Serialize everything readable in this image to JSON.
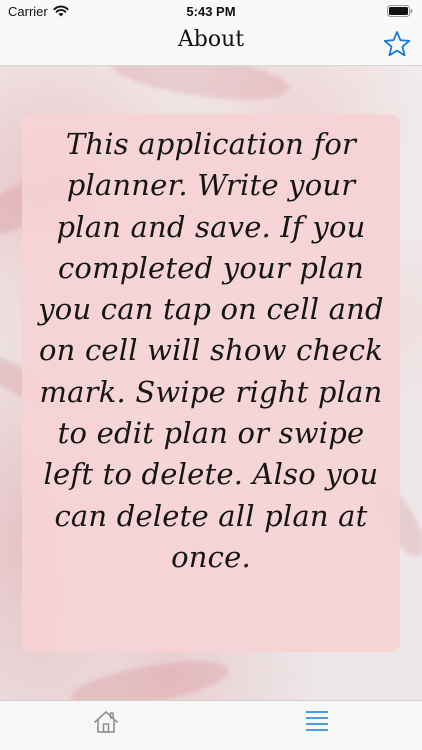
{
  "status_bar": {
    "carrier": "Carrier",
    "time": "5:43 PM"
  },
  "nav": {
    "title": "About",
    "favorite_icon": "star-outline-icon"
  },
  "content": {
    "about_text": "This application for planner. Write your plan and save. If you completed your plan you can tap on cell and on cell will show check mark. Swipe right plan to edit plan or swipe left to delete. Also you can delete all plan at once."
  },
  "tab_bar": {
    "tabs": [
      {
        "icon": "home-icon",
        "selected": false
      },
      {
        "icon": "list-icon",
        "selected": true
      }
    ]
  },
  "colors": {
    "accent": "#1a7bdc",
    "card_background": "#f6d3d5",
    "inactive_icon": "#8e8e93"
  }
}
